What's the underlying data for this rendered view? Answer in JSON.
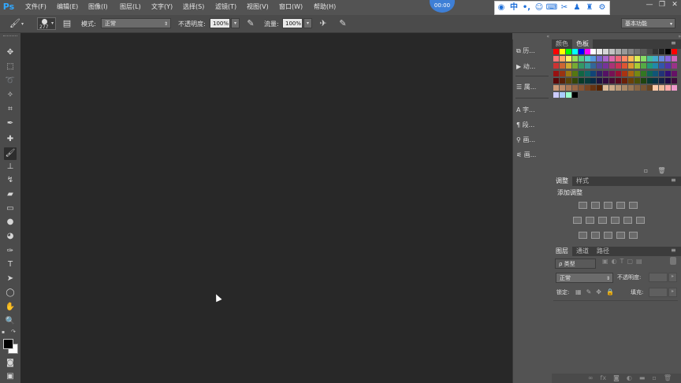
{
  "app": {
    "logo": "Ps",
    "clock": "00:00"
  },
  "menu": [
    "文件(F)",
    "编辑(E)",
    "图像(I)",
    "图层(L)",
    "文字(Y)",
    "选择(S)",
    "滤镜(T)",
    "视图(V)",
    "窗口(W)",
    "帮助(H)"
  ],
  "window_buttons": [
    "—",
    "❐",
    "✕"
  ],
  "ime": {
    "mode": "中"
  },
  "options": {
    "brush_size": "277",
    "mode_label": "模式:",
    "mode_value": "正常",
    "opacity_label": "不透明度:",
    "opacity_value": "100%",
    "flow_label": "流量:",
    "flow_value": "100%",
    "workspace": "基本功能"
  },
  "collapsed_panels": [
    {
      "label": "历..."
    },
    {
      "label": "动..."
    },
    {
      "label": "属..."
    },
    {
      "label": "字..."
    },
    {
      "label": "段..."
    },
    {
      "label": "画..."
    },
    {
      "label": "画..."
    }
  ],
  "color_panel": {
    "tabs": [
      "颜色",
      "色板"
    ],
    "active": 1
  },
  "adjust_panel": {
    "tabs": [
      "调整",
      "样式"
    ],
    "active": 0,
    "title": "添加调整"
  },
  "layers_panel": {
    "tabs": [
      "图层",
      "通道",
      "路径"
    ],
    "active": 0,
    "filter_kind": "ρ 类型",
    "blend_mode": "正常",
    "opacity_label": "不透明度:",
    "lock_label": "锁定:",
    "fill_label": "填充:"
  },
  "colors": {
    "canvas": "#282828",
    "ui": "#535353",
    "panel_dark": "#3c3c3c",
    "swatch_rows": [
      [
        "#ff0000",
        "#ffff00",
        "#00ff00",
        "#00ffff",
        "#0000ff",
        "#ff00ff",
        "#ffffff",
        "#ebebeb",
        "#d6d6d6",
        "#c2c2c2",
        "#adadad",
        "#999999",
        "#858585",
        "#707070",
        "#5c5c5c",
        "#474747",
        "#333333",
        "#1f1f1f",
        "#000000",
        "#ff0000"
      ],
      [
        "#ff7777",
        "#ffaa66",
        "#ffee66",
        "#99dd55",
        "#55cc88",
        "#55cccc",
        "#5599dd",
        "#7766cc",
        "#aa66cc",
        "#dd66aa",
        "#ee6677",
        "#ff8866",
        "#ffbb55",
        "#ddee55",
        "#88dd66",
        "#44bb99",
        "#44aacc",
        "#6688dd",
        "#8866dd",
        "#cc66bb"
      ],
      [
        "#cc3333",
        "#cc6633",
        "#ccaa33",
        "#77aa33",
        "#339966",
        "#339999",
        "#336699",
        "#554499",
        "#773399",
        "#aa3377",
        "#cc3355",
        "#dd5533",
        "#dd9933",
        "#aacc33",
        "#55aa44",
        "#229977",
        "#2288aa",
        "#3355aa",
        "#5533aa",
        "#993388"
      ],
      [
        "#991111",
        "#993311",
        "#997711",
        "#557711",
        "#116644",
        "#116666",
        "#114477",
        "#332266",
        "#551166",
        "#771155",
        "#991133",
        "#aa3311",
        "#aa6611",
        "#778811",
        "#337722",
        "#116655",
        "#115577",
        "#223377",
        "#331177",
        "#661166"
      ],
      [
        "#5a0808",
        "#5a2008",
        "#5a4408",
        "#344408",
        "#083a28",
        "#083a3a",
        "#082a44",
        "#1e1440",
        "#320a40",
        "#460a34",
        "#5a0a1e",
        "#6a2008",
        "#6a4008",
        "#4a5008",
        "#1e4410",
        "#083a34",
        "#083244",
        "#142044",
        "#1e0a44",
        "#3c0a3c"
      ],
      [
        "#cc9977",
        "#bb8866",
        "#aa7755",
        "#996644",
        "#885533",
        "#774422",
        "#663311",
        "#552200",
        "#ddbb99",
        "#ccaa88",
        "#bb9977",
        "#aa8866",
        "#997755",
        "#886644",
        "#775533",
        "#664422",
        "#ffccaa",
        "#eebb99",
        "#ffaaaa",
        "#ee99cc"
      ],
      [
        "#ccccff",
        "#aaccff",
        "#99ffcc",
        "#000000"
      ]
    ]
  }
}
